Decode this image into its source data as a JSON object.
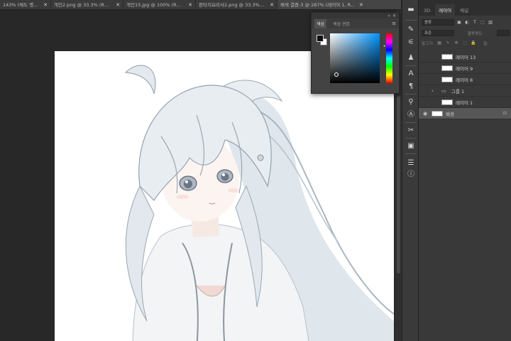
{
  "tabs": [
    {
      "label": "143% (채도 명도...",
      "close": "✕"
    },
    {
      "label": "개인2.png @ 33.3% (RG...",
      "close": "✕"
    },
    {
      "label": "개인15.jpg @ 100% (RG...",
      "close": "✕"
    },
    {
      "label": "판타지요리사2.png @ 33.3% (RGB...",
      "close": "✕"
    },
    {
      "label": "채색 결즘-3 @ 287% (레이어 1, R...",
      "close": "✕"
    }
  ],
  "color_panel": {
    "tab_color": "색상",
    "tab_swatches": "색상 견본",
    "menu": "≡",
    "collapse": "«",
    "close": "✕",
    "hue_marker": "◂"
  },
  "toolbar": {
    "items": [
      "brush-icon",
      "smudge-icon",
      "adjust-icon",
      "character-icon",
      "text-icon",
      "paragraph-icon",
      "clone-icon",
      "glyph-icon",
      "tools-icon",
      "navigator-icon",
      "properties-icon",
      "info-icon"
    ]
  },
  "layers_panel": {
    "tabs": [
      {
        "label": "3D"
      },
      {
        "label": "레이어"
      },
      {
        "label": "채널"
      }
    ],
    "kind_label": "종류",
    "blend_mode": "표준",
    "opacity_label": "불투명도:",
    "lock_label": "잠그기:",
    "fill_label": "칠:",
    "filter_glyphs": [
      "▣",
      "◐",
      "T",
      "⬚",
      "▥"
    ],
    "lock_glyphs": [
      "▦",
      "✎",
      "✥",
      "⬚",
      "🔒"
    ],
    "layers": [
      {
        "name": "레이어 13",
        "visible": false,
        "type": "layer",
        "selected": false
      },
      {
        "name": "레이어 9",
        "visible": false,
        "type": "layer",
        "selected": false
      },
      {
        "name": "레이어 8",
        "visible": false,
        "type": "layer",
        "selected": false
      },
      {
        "name": "그룹 1",
        "visible": false,
        "type": "group",
        "selected": false
      },
      {
        "name": "레이어 1",
        "visible": false,
        "type": "layer",
        "selected": false
      },
      {
        "name": "배경",
        "visible": true,
        "type": "background",
        "selected": true
      }
    ]
  },
  "colors": {
    "accent": "#0095ff",
    "panel": "#393939",
    "canvas_bg": "#282828"
  }
}
